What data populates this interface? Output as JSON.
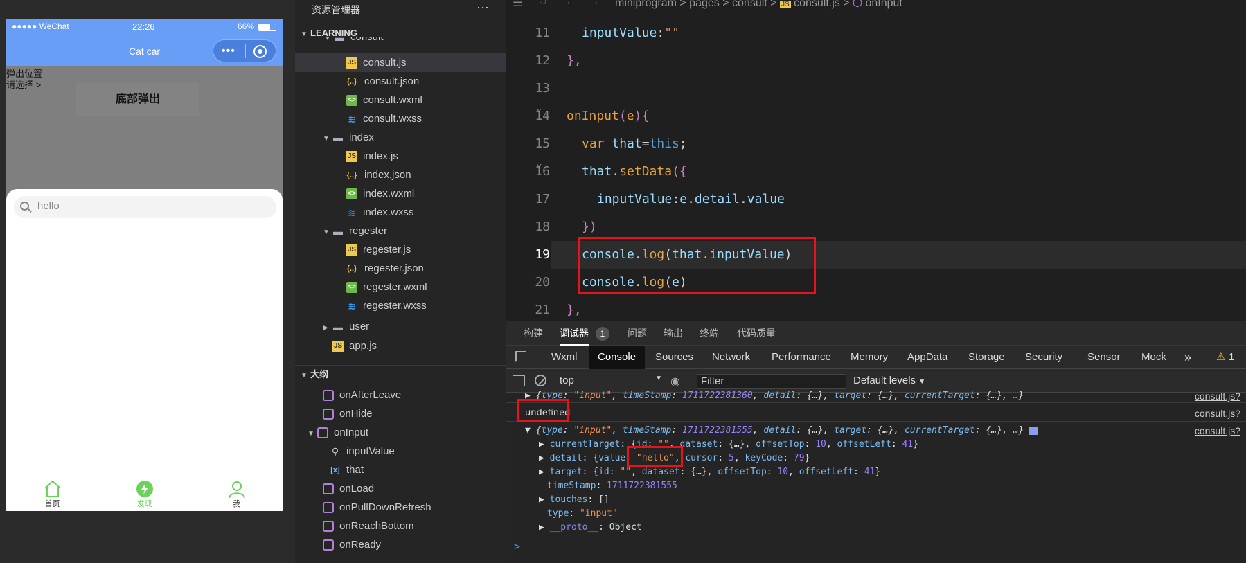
{
  "simulator": {
    "status": {
      "carrier": "●●●●● WeChat",
      "wifi": "•",
      "time": "22:26",
      "battery": "66%"
    },
    "nav_title": "Cat car",
    "popup_label": "弹出位置",
    "choose_label": "请选择 >",
    "bottom_title": "底部弹出",
    "search_value": "hello",
    "tabs": [
      {
        "label": "首页"
      },
      {
        "label": "发现"
      },
      {
        "label": "我"
      }
    ]
  },
  "explorer": {
    "title": "资源管理器",
    "more": "···",
    "project": "LEARNING",
    "consult_folder": "consult",
    "files": [
      "consult.js",
      "consult.json",
      "consult.wxml",
      "consult.wxss",
      "index",
      "index.js",
      "index.json",
      "index.wxml",
      "index.wxss",
      "regester",
      "regester.js",
      "regester.json",
      "regester.wxml",
      "regester.wxss",
      "user",
      "app.js"
    ],
    "outline_title": "大纲",
    "outline": [
      "onAfterLeave",
      "onHide",
      "onInput",
      "inputValue",
      "that",
      "onLoad",
      "onPullDownRefresh",
      "onReachBottom",
      "onReady"
    ]
  },
  "editor": {
    "breadcrumb": [
      "miniprogram",
      ">",
      "pages",
      ">",
      "consult",
      ">",
      "consult.js",
      ">",
      "onInput"
    ],
    "lines": [
      "11",
      "12",
      "13",
      "14",
      "15",
      "16",
      "17",
      "18",
      "19",
      "20",
      "21"
    ]
  },
  "panel": {
    "tabs": [
      "构建",
      "调试器",
      "问题",
      "输出",
      "终端",
      "代码质量"
    ],
    "debugger_badge": "1",
    "devtabs": [
      "Wxml",
      "Console",
      "Sources",
      "Network",
      "Performance",
      "Memory",
      "AppData",
      "Storage",
      "Security",
      "Sensor",
      "Mock"
    ],
    "warning_count": "1",
    "context": "top",
    "filter_placeholder": "Filter",
    "levels": "Default levels",
    "source_link": "consult.js?",
    "undefined_text": "undefined",
    "prompt": ">"
  },
  "colors": {
    "wechat_blue": "#689ef5",
    "green": "#6bd35a",
    "highlight_red": "#e8121b"
  }
}
